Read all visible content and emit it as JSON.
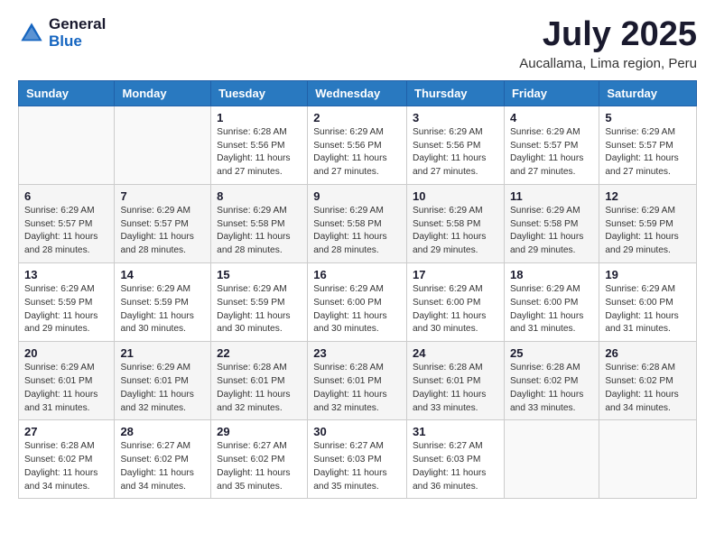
{
  "logo": {
    "general": "General",
    "blue": "Blue"
  },
  "title": "July 2025",
  "subtitle": "Aucallama, Lima region, Peru",
  "days_of_week": [
    "Sunday",
    "Monday",
    "Tuesday",
    "Wednesday",
    "Thursday",
    "Friday",
    "Saturday"
  ],
  "weeks": [
    [
      {
        "num": "",
        "info": ""
      },
      {
        "num": "",
        "info": ""
      },
      {
        "num": "1",
        "info": "Sunrise: 6:28 AM\nSunset: 5:56 PM\nDaylight: 11 hours and 27 minutes."
      },
      {
        "num": "2",
        "info": "Sunrise: 6:29 AM\nSunset: 5:56 PM\nDaylight: 11 hours and 27 minutes."
      },
      {
        "num": "3",
        "info": "Sunrise: 6:29 AM\nSunset: 5:56 PM\nDaylight: 11 hours and 27 minutes."
      },
      {
        "num": "4",
        "info": "Sunrise: 6:29 AM\nSunset: 5:57 PM\nDaylight: 11 hours and 27 minutes."
      },
      {
        "num": "5",
        "info": "Sunrise: 6:29 AM\nSunset: 5:57 PM\nDaylight: 11 hours and 27 minutes."
      }
    ],
    [
      {
        "num": "6",
        "info": "Sunrise: 6:29 AM\nSunset: 5:57 PM\nDaylight: 11 hours and 28 minutes."
      },
      {
        "num": "7",
        "info": "Sunrise: 6:29 AM\nSunset: 5:57 PM\nDaylight: 11 hours and 28 minutes."
      },
      {
        "num": "8",
        "info": "Sunrise: 6:29 AM\nSunset: 5:58 PM\nDaylight: 11 hours and 28 minutes."
      },
      {
        "num": "9",
        "info": "Sunrise: 6:29 AM\nSunset: 5:58 PM\nDaylight: 11 hours and 28 minutes."
      },
      {
        "num": "10",
        "info": "Sunrise: 6:29 AM\nSunset: 5:58 PM\nDaylight: 11 hours and 29 minutes."
      },
      {
        "num": "11",
        "info": "Sunrise: 6:29 AM\nSunset: 5:58 PM\nDaylight: 11 hours and 29 minutes."
      },
      {
        "num": "12",
        "info": "Sunrise: 6:29 AM\nSunset: 5:59 PM\nDaylight: 11 hours and 29 minutes."
      }
    ],
    [
      {
        "num": "13",
        "info": "Sunrise: 6:29 AM\nSunset: 5:59 PM\nDaylight: 11 hours and 29 minutes."
      },
      {
        "num": "14",
        "info": "Sunrise: 6:29 AM\nSunset: 5:59 PM\nDaylight: 11 hours and 30 minutes."
      },
      {
        "num": "15",
        "info": "Sunrise: 6:29 AM\nSunset: 5:59 PM\nDaylight: 11 hours and 30 minutes."
      },
      {
        "num": "16",
        "info": "Sunrise: 6:29 AM\nSunset: 6:00 PM\nDaylight: 11 hours and 30 minutes."
      },
      {
        "num": "17",
        "info": "Sunrise: 6:29 AM\nSunset: 6:00 PM\nDaylight: 11 hours and 30 minutes."
      },
      {
        "num": "18",
        "info": "Sunrise: 6:29 AM\nSunset: 6:00 PM\nDaylight: 11 hours and 31 minutes."
      },
      {
        "num": "19",
        "info": "Sunrise: 6:29 AM\nSunset: 6:00 PM\nDaylight: 11 hours and 31 minutes."
      }
    ],
    [
      {
        "num": "20",
        "info": "Sunrise: 6:29 AM\nSunset: 6:01 PM\nDaylight: 11 hours and 31 minutes."
      },
      {
        "num": "21",
        "info": "Sunrise: 6:29 AM\nSunset: 6:01 PM\nDaylight: 11 hours and 32 minutes."
      },
      {
        "num": "22",
        "info": "Sunrise: 6:28 AM\nSunset: 6:01 PM\nDaylight: 11 hours and 32 minutes."
      },
      {
        "num": "23",
        "info": "Sunrise: 6:28 AM\nSunset: 6:01 PM\nDaylight: 11 hours and 32 minutes."
      },
      {
        "num": "24",
        "info": "Sunrise: 6:28 AM\nSunset: 6:01 PM\nDaylight: 11 hours and 33 minutes."
      },
      {
        "num": "25",
        "info": "Sunrise: 6:28 AM\nSunset: 6:02 PM\nDaylight: 11 hours and 33 minutes."
      },
      {
        "num": "26",
        "info": "Sunrise: 6:28 AM\nSunset: 6:02 PM\nDaylight: 11 hours and 34 minutes."
      }
    ],
    [
      {
        "num": "27",
        "info": "Sunrise: 6:28 AM\nSunset: 6:02 PM\nDaylight: 11 hours and 34 minutes."
      },
      {
        "num": "28",
        "info": "Sunrise: 6:27 AM\nSunset: 6:02 PM\nDaylight: 11 hours and 34 minutes."
      },
      {
        "num": "29",
        "info": "Sunrise: 6:27 AM\nSunset: 6:02 PM\nDaylight: 11 hours and 35 minutes."
      },
      {
        "num": "30",
        "info": "Sunrise: 6:27 AM\nSunset: 6:03 PM\nDaylight: 11 hours and 35 minutes."
      },
      {
        "num": "31",
        "info": "Sunrise: 6:27 AM\nSunset: 6:03 PM\nDaylight: 11 hours and 36 minutes."
      },
      {
        "num": "",
        "info": ""
      },
      {
        "num": "",
        "info": ""
      }
    ]
  ]
}
